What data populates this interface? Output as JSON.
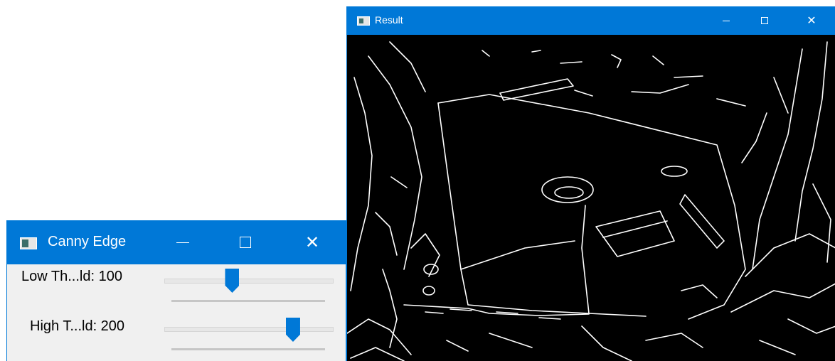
{
  "result_window": {
    "title": "Result",
    "icon": "app-window-icon",
    "controls": [
      "minimize-icon",
      "maximize-icon",
      "close-icon"
    ],
    "close_glyph": "✕",
    "image_description_colors": {
      "background": "#000000",
      "edges": "#ffffff"
    }
  },
  "canny_window": {
    "title": "Canny Edge",
    "icon": "app-window-icon",
    "close_glyph": "✕",
    "trackbars": [
      {
        "label": "Low Th...ld: 100",
        "value": 100,
        "max": 255
      },
      {
        "label": "High T...ld: 200",
        "value": 200,
        "max": 255
      }
    ]
  },
  "colors": {
    "titlebar": "#0078d7",
    "panel": "#f0f0f0",
    "thumb": "#0078d7"
  }
}
